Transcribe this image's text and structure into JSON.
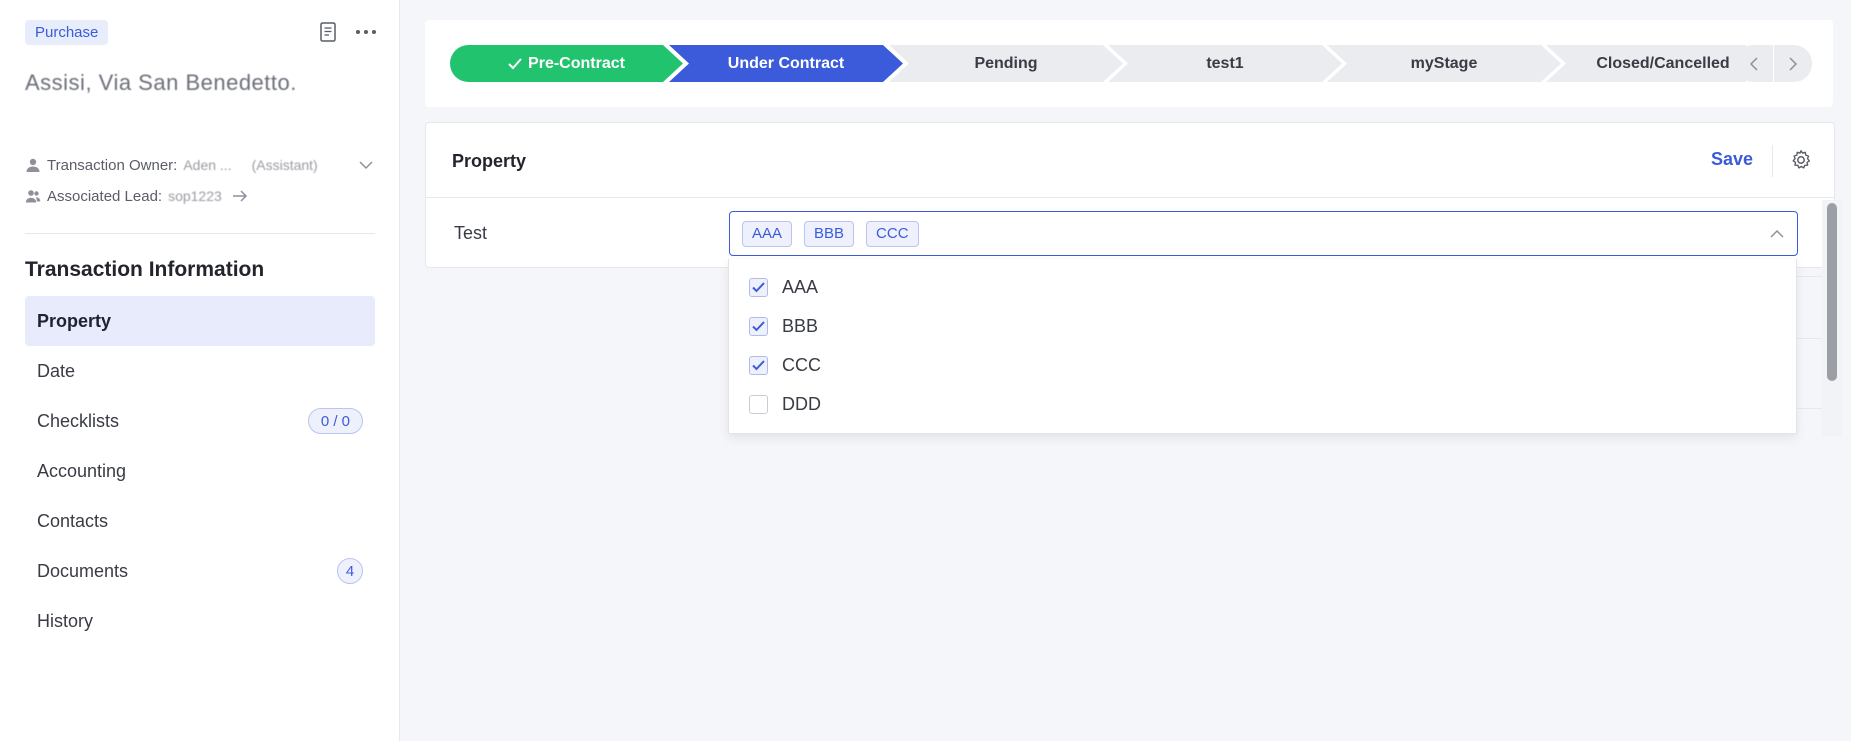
{
  "sidebar": {
    "type_badge": "Purchase",
    "address": "Assisi, Via San Benedetto.",
    "owner_label": "Transaction Owner:",
    "owner_name": "Aden ...",
    "owner_role": "(Assistant)",
    "lead_label": "Associated Lead:",
    "lead_name": "sop1223",
    "section_title": "Transaction Information",
    "nav": [
      {
        "label": "Property",
        "badge": ""
      },
      {
        "label": "Date",
        "badge": ""
      },
      {
        "label": "Checklists",
        "badge": "0 / 0"
      },
      {
        "label": "Accounting",
        "badge": ""
      },
      {
        "label": "Contacts",
        "badge": ""
      },
      {
        "label": "Documents",
        "badge": "4"
      },
      {
        "label": "History",
        "badge": ""
      }
    ]
  },
  "stages": [
    {
      "label": "Pre-Contract",
      "state": "done",
      "color": "#22c36e"
    },
    {
      "label": "Under Contract",
      "state": "current",
      "color": "#3b5bdb"
    },
    {
      "label": "Pending",
      "state": "todo",
      "color": "#ebecf0"
    },
    {
      "label": "test1",
      "state": "todo",
      "color": "#ebecf0"
    },
    {
      "label": "myStage",
      "state": "todo",
      "color": "#ebecf0"
    },
    {
      "label": "Closed/Cancelled",
      "state": "todo",
      "color": "#ebecf0"
    }
  ],
  "property": {
    "title": "Property",
    "save_label": "Save",
    "field_label": "Test",
    "selected_tags": [
      "AAA",
      "BBB",
      "CCC"
    ],
    "options": [
      {
        "label": "AAA",
        "checked": true
      },
      {
        "label": "BBB",
        "checked": true
      },
      {
        "label": "CCC",
        "checked": true
      },
      {
        "label": "DDD",
        "checked": false
      }
    ]
  },
  "colors": {
    "accent": "#3b5bdb",
    "success": "#22c36e"
  }
}
